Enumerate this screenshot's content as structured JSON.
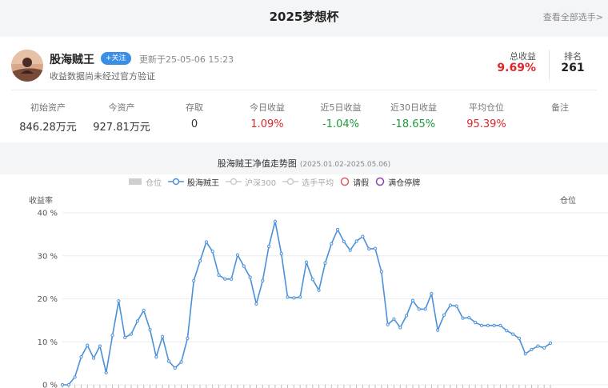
{
  "header": {
    "title": "2025梦想杯",
    "view_all": "查看全部选手>"
  },
  "player": {
    "name": "股海贼王",
    "follow_label": "+关注",
    "updated": "更新于25-05-06 15:23",
    "note": "收益数据尚未经过官方验证",
    "total_return_label": "总收益",
    "total_return_value": "9.69%",
    "rank_label": "排名",
    "rank_value": "261"
  },
  "stats": [
    {
      "label": "初始资产",
      "value": "846.28万元",
      "tone": "neutral"
    },
    {
      "label": "今资产",
      "value": "927.81万元",
      "tone": "neutral"
    },
    {
      "label": "存取",
      "value": "0",
      "tone": "neutral"
    },
    {
      "label": "今日收益",
      "value": "1.09%",
      "tone": "up"
    },
    {
      "label": "近5日收益",
      "value": "-1.04%",
      "tone": "down"
    },
    {
      "label": "近30日收益",
      "value": "-18.65%",
      "tone": "down"
    },
    {
      "label": "平均仓位",
      "value": "95.39%",
      "tone": "up"
    },
    {
      "label": "备注",
      "value": "",
      "tone": "neutral"
    }
  ],
  "chart": {
    "title": "股海贼王净值走势图",
    "range": "(2025.01.02-2025.05.06)",
    "legend": [
      {
        "label": "仓位",
        "icon": "square-icon",
        "active": false
      },
      {
        "label": "股海贼王",
        "icon": "line-circle-icon",
        "active": true
      },
      {
        "label": "沪深300",
        "icon": "line-circle-icon",
        "active": false
      },
      {
        "label": "选手平均",
        "icon": "line-circle-icon",
        "active": false
      },
      {
        "label": "请假",
        "icon": "circle-icon",
        "active": true
      },
      {
        "label": "满仓停牌",
        "icon": "circle-icon",
        "active": true
      }
    ],
    "ylabel": "收益率",
    "right_label": "仓位",
    "colors": {
      "series": "#4a90d9",
      "leave": "#e05a6a",
      "suspend": "#8e44ad",
      "grid": "#ececec"
    }
  },
  "chart_data": {
    "type": "line",
    "title": "股海贼王净值走势图",
    "ylabel": "收益率",
    "y_unit": "%",
    "yticks": [
      "0 %",
      "10 %",
      "20 %",
      "30 %",
      "40 %"
    ],
    "ylim": [
      0,
      40
    ],
    "grid": true,
    "legend_position": "top",
    "series": [
      {
        "name": "股海贼王",
        "values": [
          0,
          0,
          1.8,
          6.5,
          9.2,
          6.2,
          9,
          2.8,
          11.5,
          19.5,
          11,
          11.8,
          14.8,
          17.3,
          12.8,
          6.5,
          11.2,
          5.5,
          3.9,
          5.3,
          10.8,
          24.2,
          28.8,
          33.2,
          31,
          25.5,
          24.6,
          24.6,
          30.2,
          27.6,
          25,
          18.8,
          24.2,
          32.2,
          38,
          30.5,
          20.4,
          20.2,
          20.4,
          28.5,
          24.5,
          22,
          28.3,
          32.8,
          36.1,
          33.3,
          31.3,
          33.4,
          34.5,
          31.6,
          31.7,
          26.3,
          14,
          15.3,
          13.3,
          16.1,
          19.6,
          17.6,
          17.6,
          21.2,
          12.7,
          16.2,
          18.5,
          18.3,
          15.5,
          15.6,
          14.5,
          13.8,
          13.8,
          13.8,
          13.8,
          12.6,
          11.8,
          10.8,
          7.2,
          8.2,
          9,
          8.6,
          9.69
        ]
      }
    ]
  }
}
